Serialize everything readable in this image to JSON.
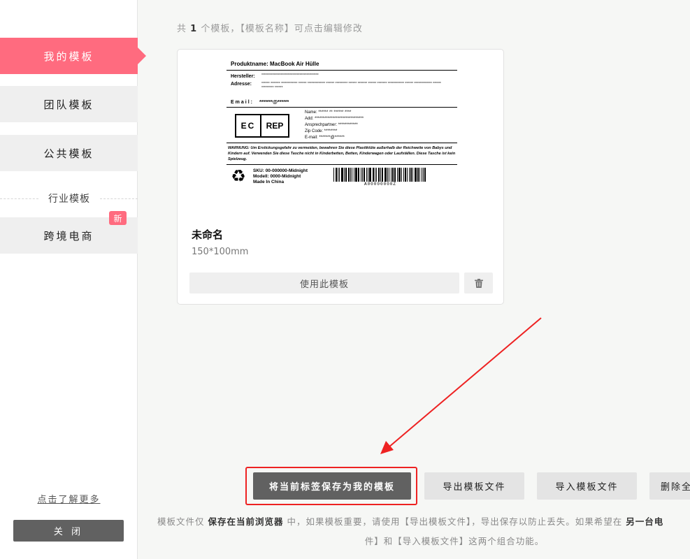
{
  "sidebar": {
    "items": [
      {
        "label": "我的模板",
        "active": true
      },
      {
        "label": "团队模板"
      },
      {
        "label": "公共模板"
      }
    ],
    "section_title": "行业模板",
    "industry_item": {
      "label": "跨境电商",
      "badge": "新"
    },
    "learn_more": "点击了解更多",
    "close": "关 闭"
  },
  "summary": {
    "prefix": "共",
    "count": "1",
    "suffix": "个模板，【模板名称】可点击编辑修改"
  },
  "template_card": {
    "name": "未命名",
    "size": "150*100mm",
    "use_button": "使用此模板",
    "delete_icon": "trash-icon",
    "preview": {
      "title": "Produktname: MacBook Air Hülle",
      "hersteller_label": "Hersteller:",
      "adresse_label": "Adresse:",
      "hersteller_value": "******************************************",
      "adresse_value": "****** ******* ************ ****** ************* ****** ********* ****** ******* ****** ******* ************ ****** ************* ****** ********* ******",
      "email_label": "Email:",
      "email_value": "*******@******",
      "ec": "EC",
      "rep": "REP",
      "rep_lines": [
        "Name: ****** ** ****** ****",
        "Add: ******************************",
        "Ansprechpartner: ************",
        "Zip Code: ********",
        "E-mail: *******@******"
      ],
      "warning": "WARNUNG: Um Erstickungsgefahr zu vermeiden, bewahren Sie diese Plastiktüte außerhalb der Reichweite von Babys und Kindern auf. Verwenden Sie diese Tasche nicht in Kinderbetten, Betten, Kinderwagen oder Laufställen. Diese Tasche ist kein Spielzeug.",
      "recycle_icon": "recycle-icon",
      "sku_lines": [
        "SKU: 00-000000-Midnight",
        "Modell: 0000-Midnight",
        "Made In China"
      ],
      "barcode_text": "A00000000Z"
    }
  },
  "actions": {
    "save": "将当前标签保存为我的模板",
    "export": "导出模板文件",
    "import": "导入模板文件",
    "delete_all": "删除全"
  },
  "note": {
    "line1_a": "模板文件仅",
    "line1_b": "保存在当前浏览器",
    "line1_c": "中，如果模板重要，请使用【导出模板文件】，导出保存以防止丢失。如果希望在",
    "line1_d": "另一台电",
    "line2": "件】和【导入模板文件】这两个组合功能。"
  },
  "colors": {
    "accent": "#ff6b7f",
    "dark_button": "#616161",
    "highlight": "#ee2222"
  }
}
